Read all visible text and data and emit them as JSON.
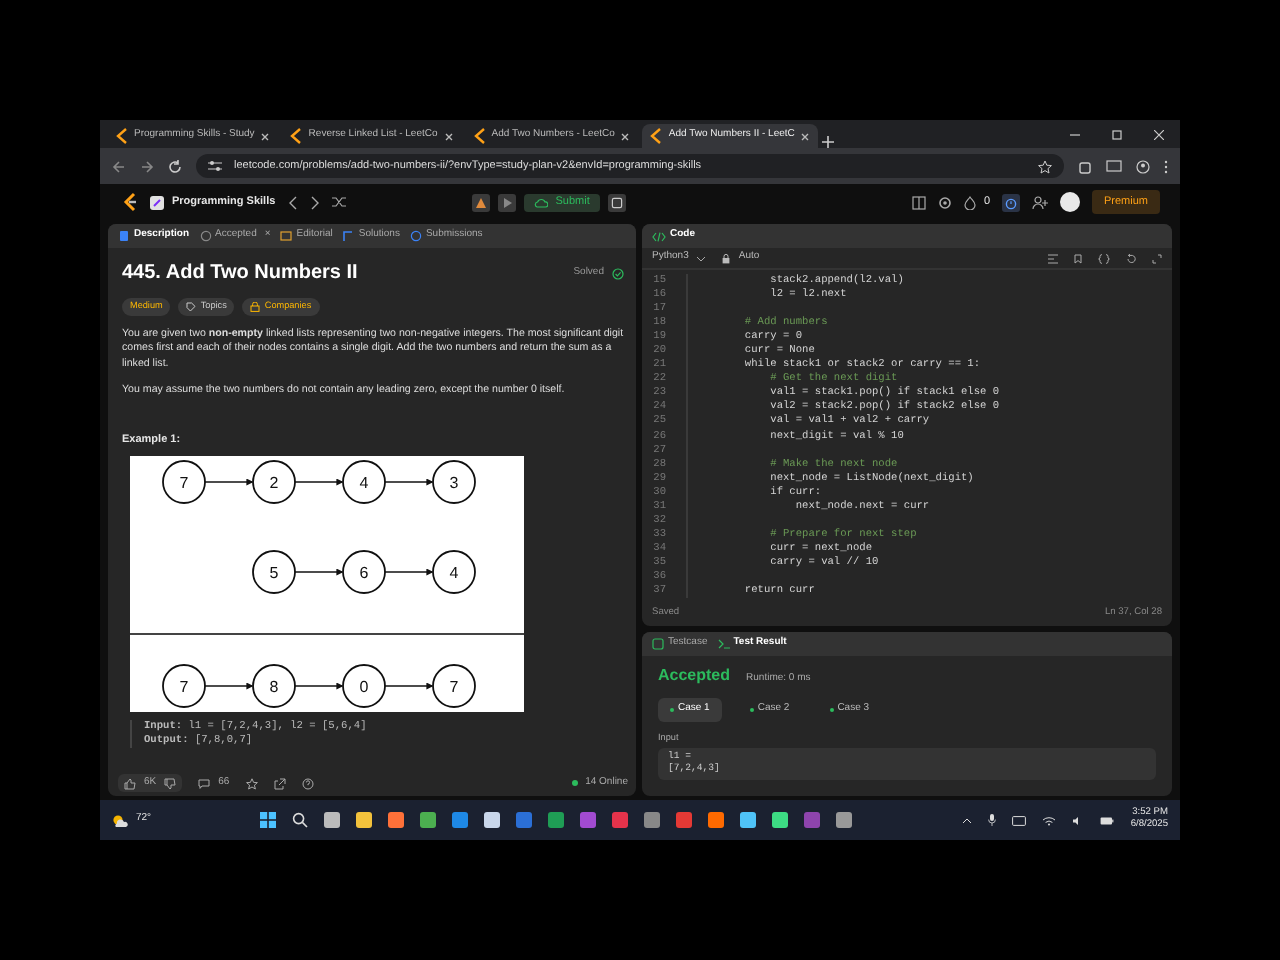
{
  "browser": {
    "tabs": [
      {
        "title": "Programming Skills - Study",
        "selected": false
      },
      {
        "title": "Reverse Linked List - LeetCo",
        "selected": false
      },
      {
        "title": "Add Two Numbers - LeetCo",
        "selected": false
      },
      {
        "title": "Add Two Numbers II - LeetC",
        "selected": true
      }
    ],
    "address": "leetcode.com/problems/add-two-numbers-ii/?envType=study-plan-v2&envId=programming-skills"
  },
  "topbar": {
    "study_plan": "Programming Skills",
    "submit": "Submit",
    "streak": "0",
    "premium": "Premium"
  },
  "problem": {
    "tabs": [
      {
        "label": "Description",
        "kind": "description",
        "selected": true
      },
      {
        "label": "Accepted",
        "kind": "accepted",
        "selected": false,
        "close": "×"
      },
      {
        "label": "Editorial",
        "kind": "editorial",
        "selected": false
      },
      {
        "label": "Solutions",
        "kind": "solutions",
        "selected": false
      },
      {
        "label": "Submissions",
        "kind": "submissions",
        "selected": false
      }
    ],
    "title": "445. Add Two Numbers II",
    "status": "Solved",
    "tags": [
      {
        "label": "Medium",
        "kind": "difficulty"
      },
      {
        "label": "Topics",
        "kind": "topics"
      },
      {
        "label": "Companies",
        "kind": "companies"
      }
    ],
    "paragraphs": [
      "You are given two **non-empty** linked lists representing two non-negative integers. The most significant digit comes first and each of their nodes contains a single digit. Add the two numbers and return the sum as a linked list.",
      "You may assume the two numbers do not contain any leading zero, except the number 0 itself."
    ],
    "example_heading": "Example 1:",
    "diagram": {
      "sections": [
        {
          "rows": [
            {
              "kind": "full",
              "nodes": [
                "7",
                "2",
                "4",
                "3"
              ]
            },
            {
              "kind": "shifted",
              "nodes": [
                "5",
                "6",
                "4"
              ]
            }
          ]
        },
        {
          "rows": [
            {
              "kind": "full",
              "nodes": [
                "7",
                "8",
                "0",
                "7"
              ]
            }
          ]
        }
      ]
    },
    "example_io": [
      {
        "label": "Input:",
        "value": "l1 = [7,2,4,3], l2 = [5,6,4]"
      },
      {
        "label": "Output:",
        "value": "[7,8,0,7]"
      }
    ],
    "footer": {
      "likes": "6K",
      "comments": "66",
      "online": "14 Online"
    }
  },
  "editor": {
    "title": "Code",
    "language": "Python3",
    "mode": "Auto",
    "lines": [
      {
        "number": "15",
        "kind": "code",
        "text": "            stack2.append(l2.val)"
      },
      {
        "number": "16",
        "kind": "code",
        "text": "            l2 = l2.next"
      },
      {
        "number": "17",
        "kind": "code"
      },
      {
        "number": "18",
        "kind": "comment",
        "text": "        # Add numbers"
      },
      {
        "number": "19",
        "kind": "code",
        "text": "        carry = 0"
      },
      {
        "number": "20",
        "kind": "code",
        "text": "        curr = None"
      },
      {
        "number": "21",
        "kind": "code",
        "text": "        while stack1 or stack2 or carry == 1:"
      },
      {
        "number": "22",
        "kind": "comment",
        "text": "            # Get the next digit"
      },
      {
        "number": "23",
        "kind": "code",
        "text": "            val1 = stack1.pop() if stack1 else 0"
      },
      {
        "number": "24",
        "kind": "code",
        "text": "            val2 = stack2.pop() if stack2 else 0"
      },
      {
        "number": "25",
        "kind": "code",
        "text": "            val = val1 + val2 + carry"
      },
      {
        "number": "26",
        "kind": "code",
        "text": "            next_digit = val % 10"
      },
      {
        "number": "27",
        "kind": "code"
      },
      {
        "number": "28",
        "kind": "comment",
        "text": "            # Make the next node"
      },
      {
        "number": "29",
        "kind": "code",
        "text": "            next_node = ListNode(next_digit)"
      },
      {
        "number": "30",
        "kind": "code",
        "text": "            if curr:"
      },
      {
        "number": "31",
        "kind": "code",
        "text": "                next_node.next = curr"
      },
      {
        "number": "32",
        "kind": "code"
      },
      {
        "number": "33",
        "kind": "comment",
        "text": "            # Prepare for next step"
      },
      {
        "number": "34",
        "kind": "code",
        "text": "            curr = next_node"
      },
      {
        "number": "35",
        "kind": "code",
        "text": "            carry = val // 10"
      },
      {
        "number": "36",
        "kind": "code"
      },
      {
        "number": "37",
        "kind": "code",
        "text": "        return curr"
      }
    ],
    "status": "Saved",
    "cursor": "Ln 37, Col 28"
  },
  "result": {
    "tabs": [
      {
        "label": "Testcase",
        "kind": "testcase",
        "selected": false
      },
      {
        "label": "Test Result",
        "kind": "result",
        "selected": true
      }
    ],
    "verdict": "Accepted",
    "runtime": "Runtime: 0 ms",
    "cases": [
      {
        "label": "Case 1",
        "selected": true
      },
      {
        "label": "Case 2",
        "selected": false
      },
      {
        "label": "Case 3",
        "selected": false
      }
    ],
    "input_label": "Input",
    "inputs": [
      {
        "name": "l1 =",
        "value": "[7,2,4,3]"
      }
    ]
  },
  "taskbar": {
    "temperature": "72°",
    "time": "3:52 PM",
    "date": "6/8/2025"
  }
}
